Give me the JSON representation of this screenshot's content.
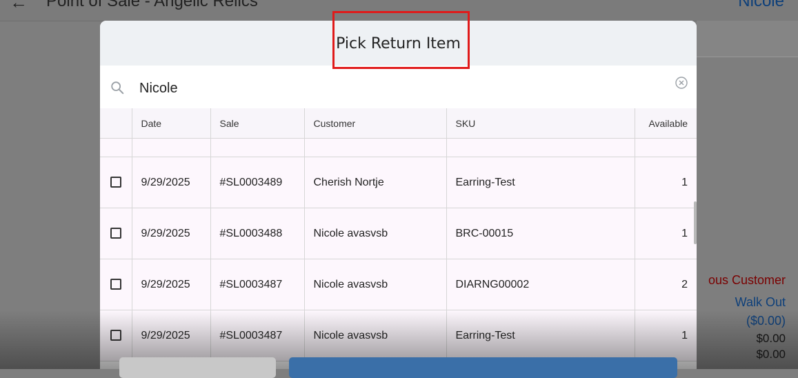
{
  "app": {
    "back_icon": "arrow-left-icon",
    "title": "Point of Sale - Angelic Relics",
    "user": "Nicole",
    "customer_label": "ous Customer",
    "walk_out": "Walk Out",
    "amount_paren": "($0.00)",
    "amount_1": "$0.00",
    "amount_2": "$0.00"
  },
  "modal": {
    "title": "Pick Return Item",
    "search": {
      "value": "Nicole",
      "icon": "search-icon",
      "clear_icon": "clear-circle-icon"
    },
    "columns": [
      "Date",
      "Sale",
      "Customer",
      "SKU",
      "Available"
    ],
    "rows": [
      {
        "date": "9/29/2025",
        "sale": "#SL0003489",
        "customer": "Cherish Nortje",
        "sku": "Earring-Test",
        "available": "1"
      },
      {
        "date": "9/29/2025",
        "sale": "#SL0003488",
        "customer": "Nicole avasvsb",
        "sku": "BRC-00015",
        "available": "1"
      },
      {
        "date": "9/29/2025",
        "sale": "#SL0003487",
        "customer": "Nicole avasvsb",
        "sku": "DIARNG00002",
        "available": "2"
      },
      {
        "date": "9/29/2025",
        "sale": "#SL0003487",
        "customer": "Nicole avasvsb",
        "sku": "Earring-Test",
        "available": "1"
      }
    ]
  },
  "colors": {
    "highlight": "#e01a1a",
    "primary_button": "#3a6fa8",
    "brand_text": "#0d3f7a",
    "warning_text": "#7a0000"
  }
}
